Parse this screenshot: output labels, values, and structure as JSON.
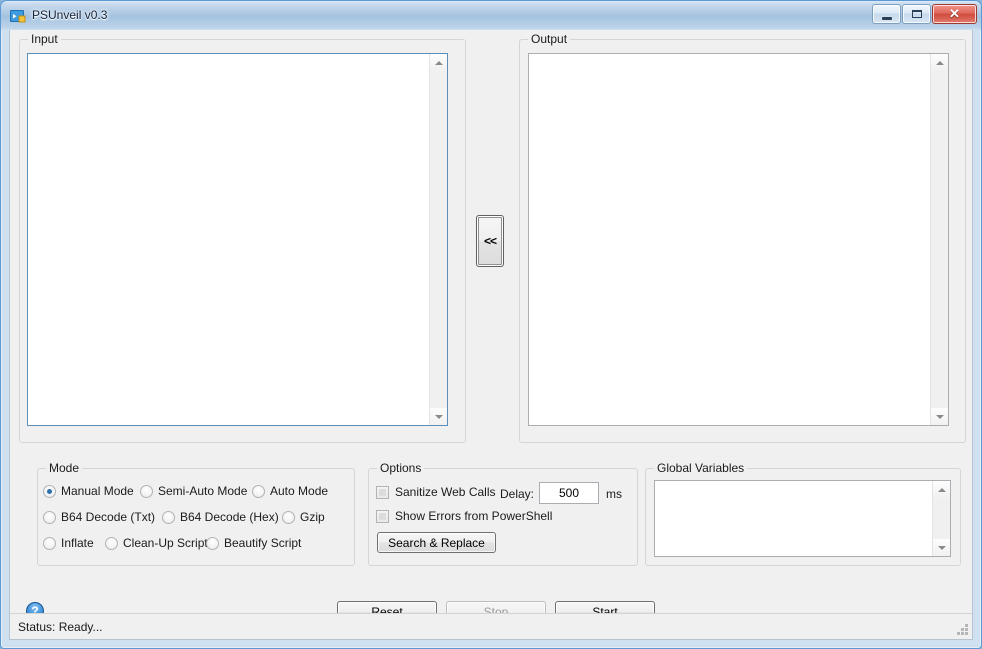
{
  "window": {
    "title": "PSUnveil v0.3",
    "icon": "app-icon",
    "buttons": {
      "minimize": "minimize-icon",
      "maximize": "maximize-icon",
      "close": "✕"
    }
  },
  "panels": {
    "input": {
      "title": "Input",
      "textarea_value": "",
      "scroll_up": "scroll-up-arrow",
      "scroll_down": "scroll-down-arrow"
    },
    "output": {
      "title": "Output",
      "textarea_value": "",
      "scroll_up": "scroll-up-arrow",
      "scroll_down": "scroll-down-arrow"
    },
    "transfer_button": "<<"
  },
  "mode": {
    "title": "Mode",
    "options": [
      {
        "label": "Manual Mode",
        "checked": true
      },
      {
        "label": "Semi-Auto Mode",
        "checked": false
      },
      {
        "label": "Auto Mode",
        "checked": false
      },
      {
        "label": "B64 Decode (Txt)",
        "checked": false
      },
      {
        "label": "B64 Decode (Hex)",
        "checked": false
      },
      {
        "label": "Gzip",
        "checked": false
      },
      {
        "label": "Inflate",
        "checked": false
      },
      {
        "label": "Clean-Up Script",
        "checked": false
      },
      {
        "label": "Beautify Script",
        "checked": false
      }
    ]
  },
  "options": {
    "title": "Options",
    "sanitize_label": "Sanitize Web Calls",
    "sanitize_checked": false,
    "show_errors_label": "Show Errors from PowerShell",
    "show_errors_checked": false,
    "delay_label": "Delay:",
    "delay_value": "500",
    "delay_unit": "ms",
    "search_replace_label": "Search & Replace"
  },
  "global_variables": {
    "title": "Global Variables",
    "textarea_value": "",
    "scroll_up": "scroll-up-arrow",
    "scroll_down": "scroll-down-arrow"
  },
  "actions": {
    "help": "?",
    "reset_label": "Reset",
    "stop_label": "Stop",
    "start_label": "Start"
  },
  "statusbar": {
    "text": "Status: Ready..."
  },
  "colors": {
    "accent": "#2c6fa8",
    "close_button": "#cf4b3d",
    "window_frame": "#5b9ad4",
    "client_bg": "#f0f0f0",
    "focus_border": "#5b8fb9"
  }
}
